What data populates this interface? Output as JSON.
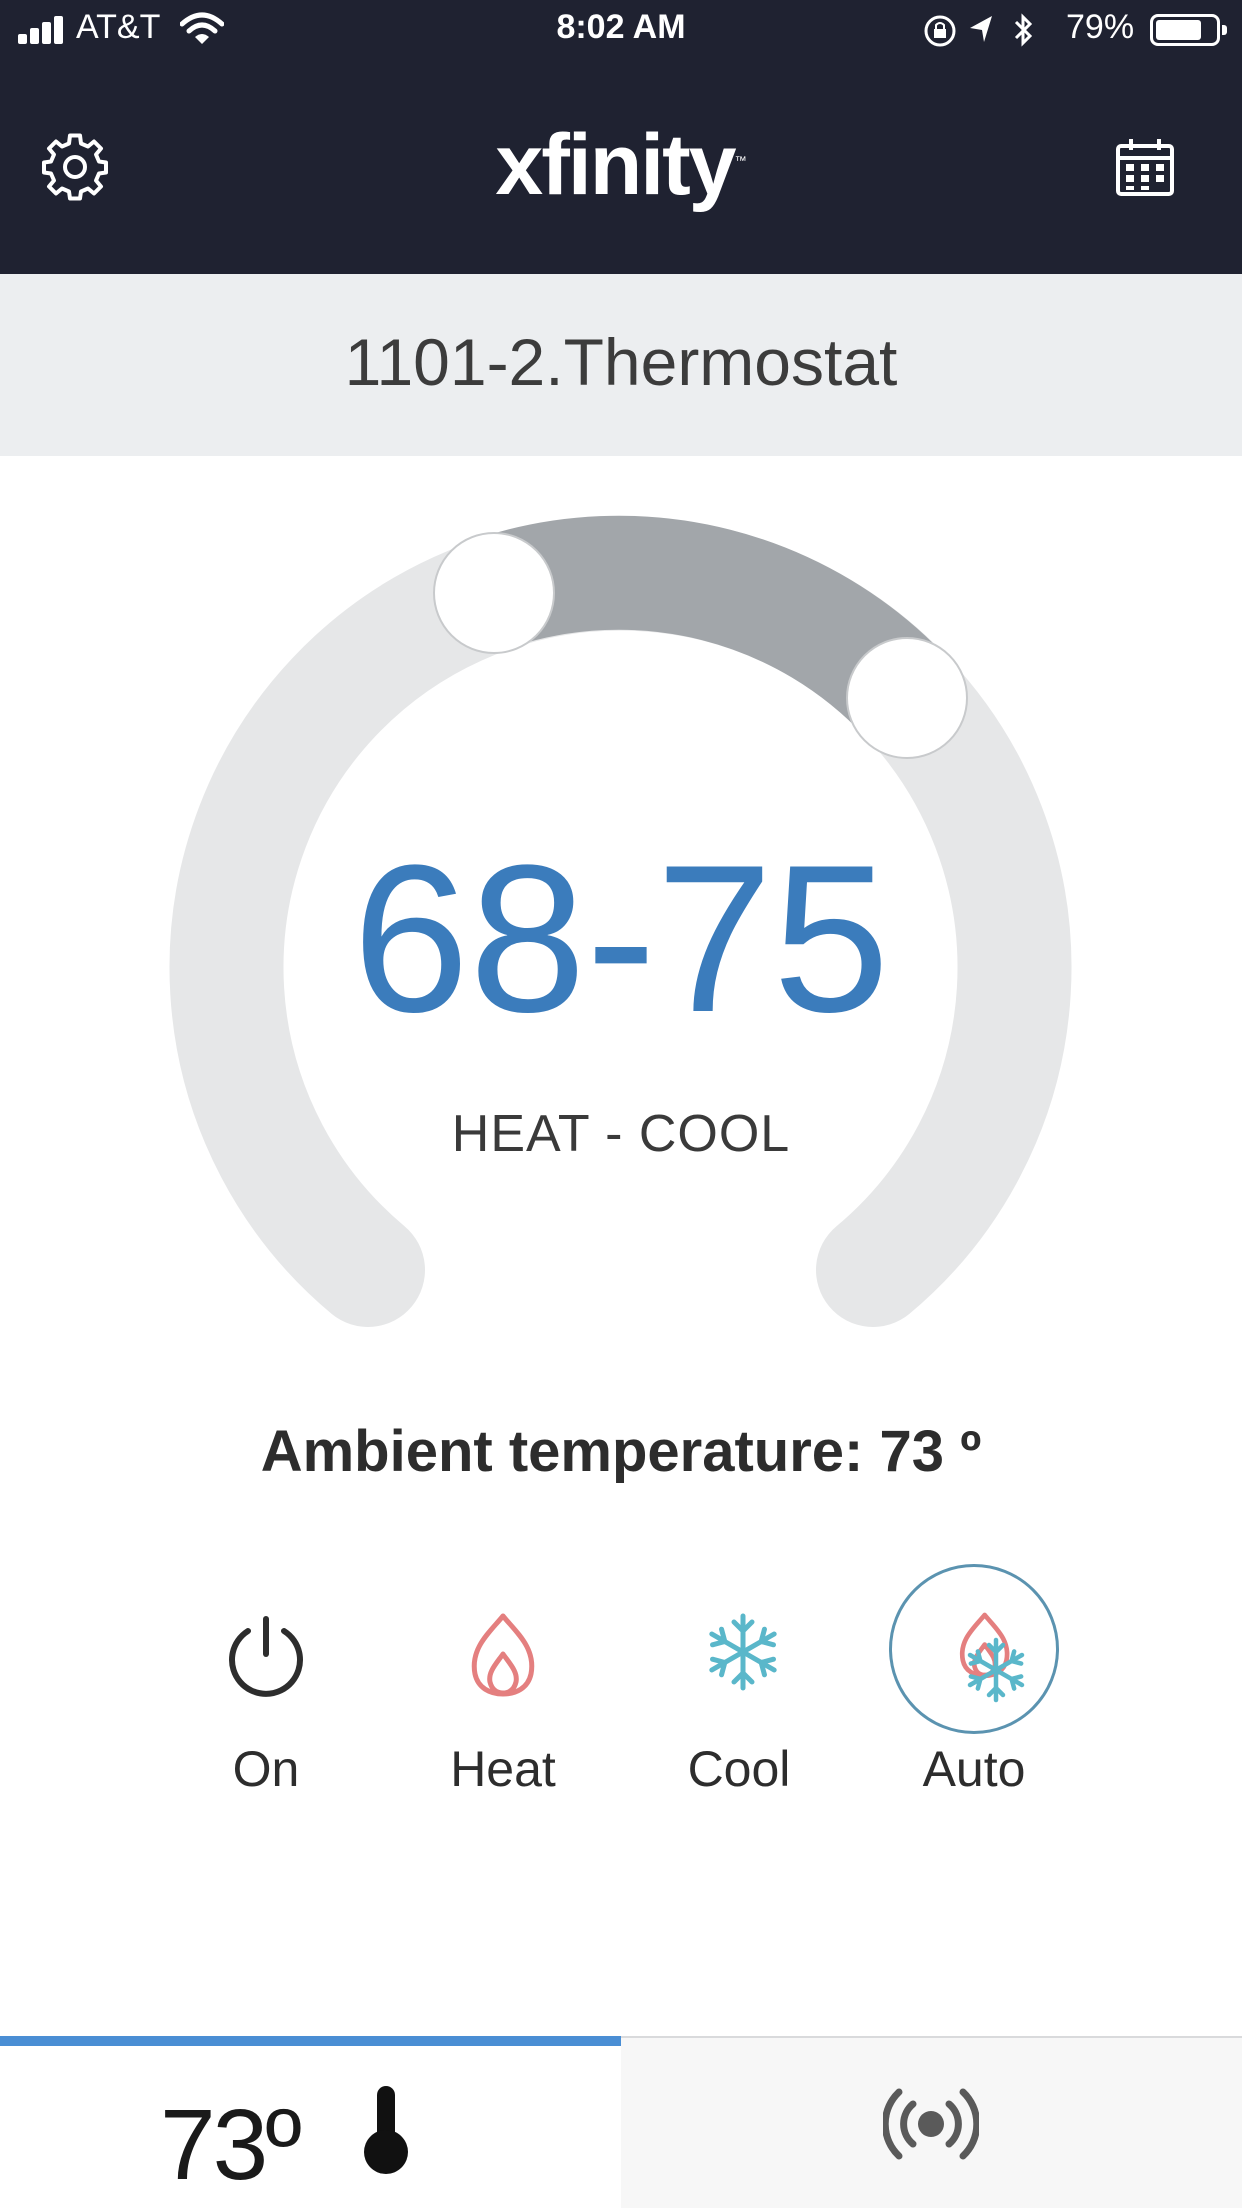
{
  "status_bar": {
    "carrier": "AT&T",
    "time": "8:02 AM",
    "battery_percent": "79%",
    "battery_level": 0.79,
    "icons": [
      "signal-icon",
      "wifi-icon",
      "orientation-lock-icon",
      "location-icon",
      "bluetooth-icon",
      "battery-icon"
    ]
  },
  "header": {
    "logo_text": "xfinity",
    "logo_mark": "™",
    "left_icon": "gear-icon",
    "right_icon": "calendar-icon"
  },
  "device": {
    "name": "1101-2.Thermostat"
  },
  "dial": {
    "setpoint_range": "68-75",
    "heat_setpoint": 68,
    "cool_setpoint": 75,
    "mode_label": "HEAT - COOL",
    "track_color": "#e6e7e8",
    "active_range_color": "#a2a6aa",
    "setpoint_color": "#3b7cbc"
  },
  "ambient": {
    "text": "Ambient temperature: 73 º"
  },
  "modes": [
    {
      "label": "On",
      "icon": "power-icon",
      "selected": false
    },
    {
      "label": "Heat",
      "icon": "flame-icon",
      "selected": false
    },
    {
      "label": "Cool",
      "icon": "snowflake-icon",
      "selected": false
    },
    {
      "label": "Auto",
      "icon": "flame-snowflake-icon",
      "selected": true
    }
  ],
  "tabbar": {
    "temperature_tab": {
      "text": "73º",
      "icon": "thermometer-icon",
      "active": true
    },
    "remote_tab": {
      "icon": "broadcast-icon",
      "active": false
    }
  },
  "colors": {
    "header_bg": "#1f2231",
    "heat": "#e47f7f",
    "cool": "#5ab7ca",
    "accent": "#4a8ed4"
  }
}
